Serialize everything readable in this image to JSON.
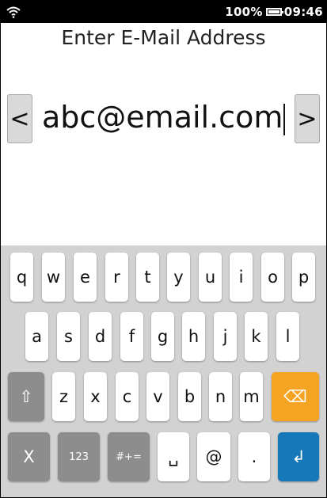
{
  "status": {
    "battery_percent": "100%",
    "time": "09:46"
  },
  "page": {
    "title": "Enter E-Mail Address"
  },
  "input": {
    "value": "abc@email.com",
    "prev_label": "<",
    "next_label": ">"
  },
  "keyboard": {
    "row1": [
      "q",
      "w",
      "e",
      "r",
      "t",
      "y",
      "u",
      "i",
      "o",
      "p"
    ],
    "row2": [
      "a",
      "s",
      "d",
      "f",
      "g",
      "h",
      "j",
      "k",
      "l"
    ],
    "row3": [
      "z",
      "x",
      "c",
      "v",
      "b",
      "n",
      "m"
    ],
    "shift_label": "⇧",
    "backspace_label": "⌫",
    "close_label": "X",
    "numbers_label": "123",
    "symbols_label": "#+=",
    "space_label": "␣",
    "at_label": "@",
    "dot_label": ".",
    "enter_label": "↲"
  },
  "colors": {
    "backspace": "#f5a323",
    "enter": "#1678b8",
    "modifier": "#8d8d8d"
  }
}
